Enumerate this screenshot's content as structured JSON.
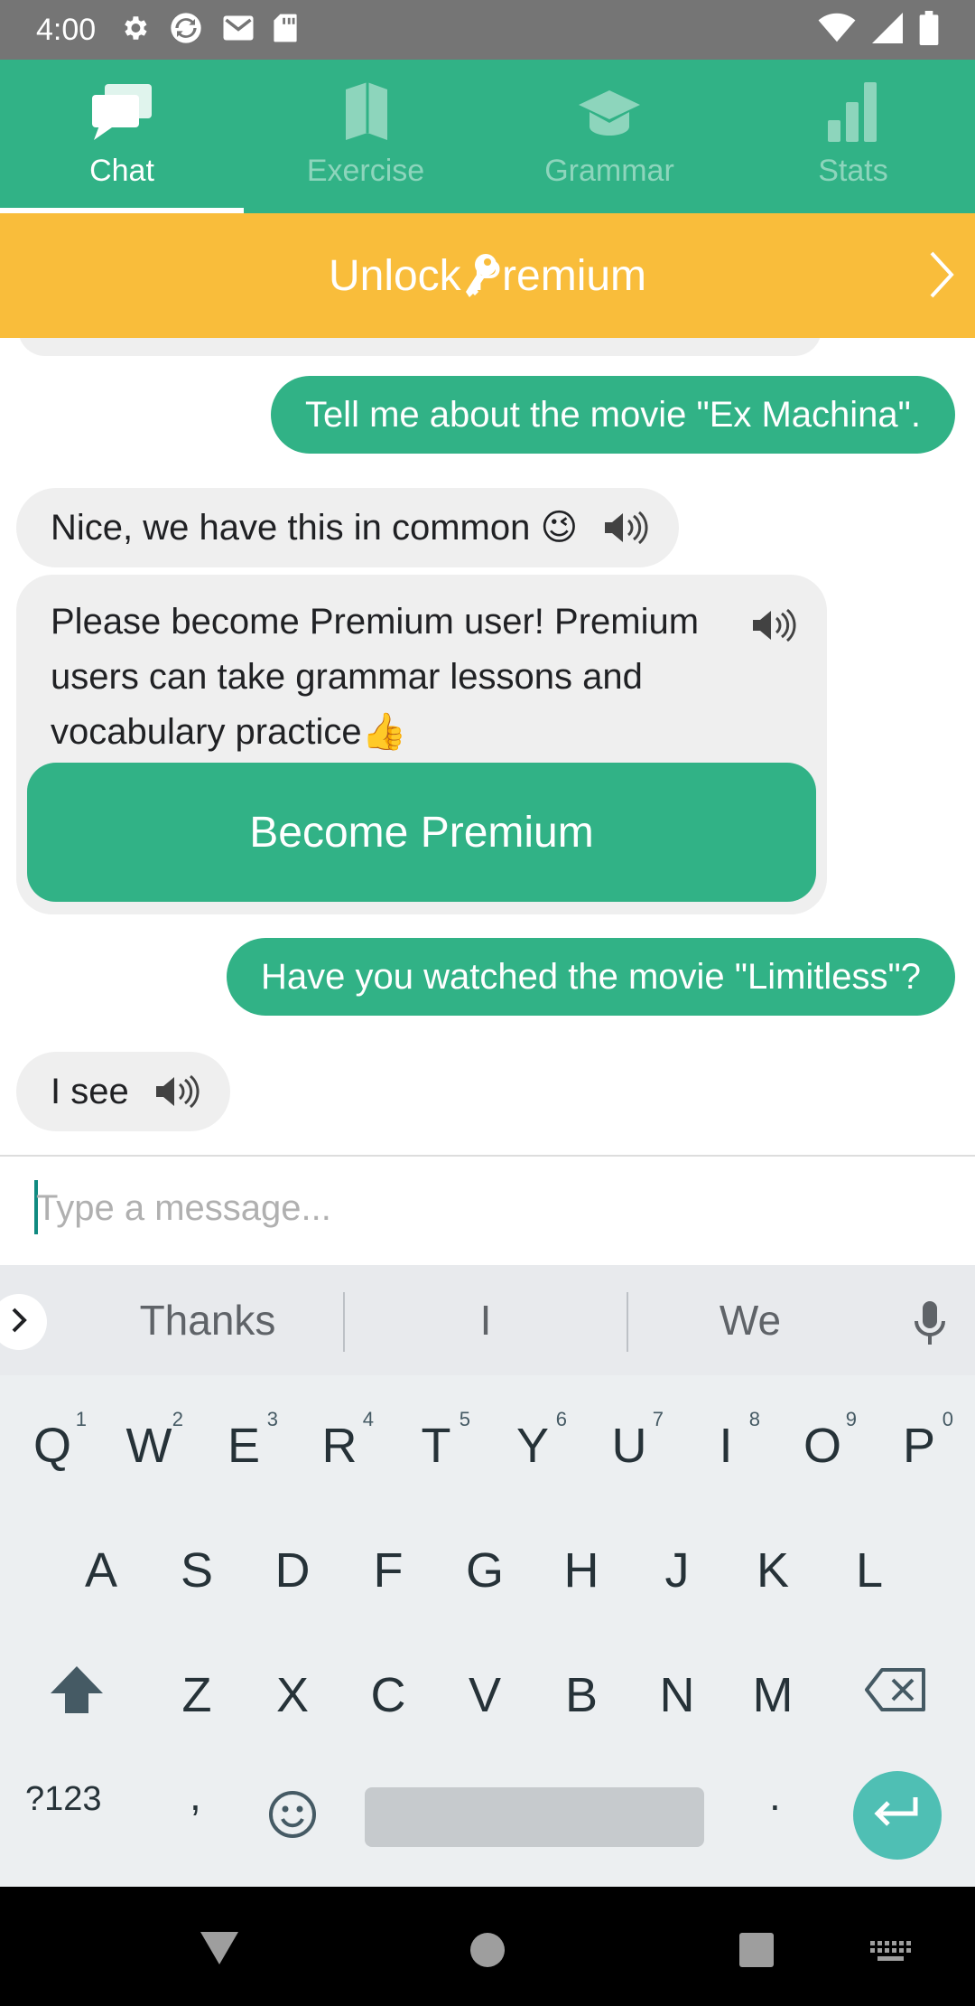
{
  "status_bar": {
    "time": "4:00",
    "left_icons": [
      "gear-icon",
      "sync-icon",
      "mail-icon",
      "sd-card-icon"
    ],
    "right_icons": [
      "wifi-icon",
      "signal-icon",
      "battery-icon"
    ]
  },
  "tabs": [
    {
      "label": "Chat",
      "icon": "chat-icon",
      "active": true
    },
    {
      "label": "Exercise",
      "icon": "book-icon",
      "active": false
    },
    {
      "label": "Grammar",
      "icon": "graduation-cap-icon",
      "active": false
    },
    {
      "label": "Stats",
      "icon": "bar-chart-icon",
      "active": false
    }
  ],
  "banner": {
    "label": "Unlock Premium",
    "icon": "key-icon",
    "color": "#f9bd3b"
  },
  "colors": {
    "brand": "#31b286",
    "banner": "#f9bd3b"
  },
  "chat": {
    "messages": [
      {
        "from": "user",
        "text": "Tell me about the movie \"Ex Machina\"."
      },
      {
        "from": "bot",
        "text": "Nice, we have this in common 😉"
      },
      {
        "from": "bot",
        "text": "Please become Premium user! Premium users can take grammar lessons and vocabulary practice👍",
        "button": "Become Premium"
      },
      {
        "from": "user",
        "text": "Have you watched the movie \"Limitless\"?"
      },
      {
        "from": "bot",
        "text": "I see"
      }
    ]
  },
  "input": {
    "placeholder": "Type a message...",
    "value": ""
  },
  "keyboard": {
    "suggestions": [
      "Thanks",
      "I",
      "We"
    ],
    "row1": [
      "Q",
      "W",
      "E",
      "R",
      "T",
      "Y",
      "U",
      "I",
      "O",
      "P"
    ],
    "row1_numbers": [
      "1",
      "2",
      "3",
      "4",
      "5",
      "6",
      "7",
      "8",
      "9",
      "0"
    ],
    "row2": [
      "A",
      "S",
      "D",
      "F",
      "G",
      "H",
      "J",
      "K",
      "L"
    ],
    "row3": [
      "Z",
      "X",
      "C",
      "V",
      "B",
      "N",
      "M"
    ],
    "symbols_key": "?123",
    "comma": ",",
    "period": "."
  }
}
